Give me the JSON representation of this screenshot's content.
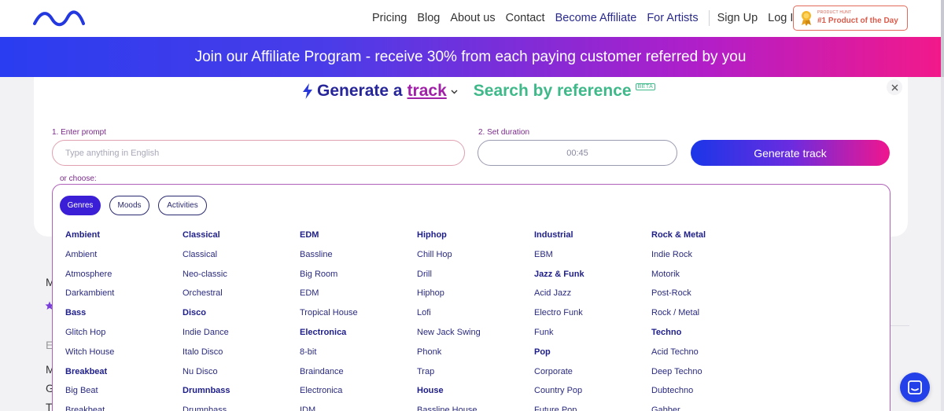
{
  "nav": {
    "links": [
      "Pricing",
      "Blog",
      "About us",
      "Contact",
      "Become Affiliate",
      "For Artists"
    ],
    "sign_up": "Sign Up",
    "log_in": "Log In",
    "badge_small": "PRODUCT HUNT",
    "badge_big": "#1 Product of the Day"
  },
  "banner": {
    "text": "Join our Affiliate Program - receive 30% from each paying customer referred by you"
  },
  "generator": {
    "title": "Generate a",
    "track_word": "track",
    "search_reference": "Search by reference",
    "beta": "BETA",
    "prompt_label": "1. Enter prompt",
    "prompt_placeholder": "Type anything in English",
    "duration_label": "2. Set duration",
    "duration_value": "00:45",
    "generate_button": "Generate track",
    "or_choose": "or choose:"
  },
  "tabs": [
    "Genres",
    "Moods",
    "Activities"
  ],
  "active_tab": "Genres",
  "columns": [
    [
      {
        "t": "Ambient",
        "head": true
      },
      {
        "t": "Ambient"
      },
      {
        "t": "Atmosphere"
      },
      {
        "t": "Darkambient"
      },
      {
        "t": "Bass",
        "head": true
      },
      {
        "t": "Glitch Hop"
      },
      {
        "t": "Witch House"
      },
      {
        "t": "Breakbeat",
        "head": true
      },
      {
        "t": "Big Beat"
      },
      {
        "t": "Breakbeat"
      }
    ],
    [
      {
        "t": "Classical",
        "head": true
      },
      {
        "t": "Classical"
      },
      {
        "t": "Neo-classic"
      },
      {
        "t": "Orchestral"
      },
      {
        "t": "Disco",
        "head": true
      },
      {
        "t": "Indie Dance"
      },
      {
        "t": "Italo Disco"
      },
      {
        "t": "Nu Disco"
      },
      {
        "t": "Drumnbass",
        "head": true
      },
      {
        "t": "Drumnbass"
      }
    ],
    [
      {
        "t": "EDM",
        "head": true
      },
      {
        "t": "Bassline"
      },
      {
        "t": "Big Room"
      },
      {
        "t": "EDM"
      },
      {
        "t": "Tropical House"
      },
      {
        "t": "Electronica",
        "head": true
      },
      {
        "t": "8-bit"
      },
      {
        "t": "Braindance"
      },
      {
        "t": "Electronica"
      },
      {
        "t": "IDM"
      }
    ],
    [
      {
        "t": "Hiphop",
        "head": true
      },
      {
        "t": "Chill Hop"
      },
      {
        "t": "Drill"
      },
      {
        "t": "Hiphop"
      },
      {
        "t": "Lofi"
      },
      {
        "t": "New Jack Swing"
      },
      {
        "t": "Phonk"
      },
      {
        "t": "Trap"
      },
      {
        "t": "House",
        "head": true
      },
      {
        "t": "Bassline House"
      }
    ],
    [
      {
        "t": "Industrial",
        "head": true
      },
      {
        "t": "EBM"
      },
      {
        "t": "Jazz & Funk",
        "head": true
      },
      {
        "t": "Acid Jazz"
      },
      {
        "t": "Electro Funk"
      },
      {
        "t": "Funk"
      },
      {
        "t": "Pop",
        "head": true
      },
      {
        "t": "Corporate"
      },
      {
        "t": "Country Pop"
      },
      {
        "t": "Future Pop"
      }
    ],
    [
      {
        "t": "Rock & Metal",
        "head": true
      },
      {
        "t": "Indie Rock"
      },
      {
        "t": "Motorik"
      },
      {
        "t": "Post-Rock"
      },
      {
        "t": "Rock / Metal"
      },
      {
        "t": "Techno",
        "head": true
      },
      {
        "t": "Acid Techno"
      },
      {
        "t": "Deep Techno"
      },
      {
        "t": "Dubtechno"
      },
      {
        "t": "Gabber"
      }
    ]
  ],
  "background_letters": [
    "M",
    "E",
    "M",
    "G",
    "T"
  ],
  "colors": {
    "brand_blue": "#26269a",
    "accent_magenta": "#a020a8",
    "reference_green": "#3fb98a",
    "chat_blue": "#2440e8"
  },
  "icons": [
    "logo-wave-icon",
    "medal-icon",
    "bolt-icon",
    "chevron-down-icon",
    "close-icon",
    "star-icon",
    "chat-icon"
  ]
}
